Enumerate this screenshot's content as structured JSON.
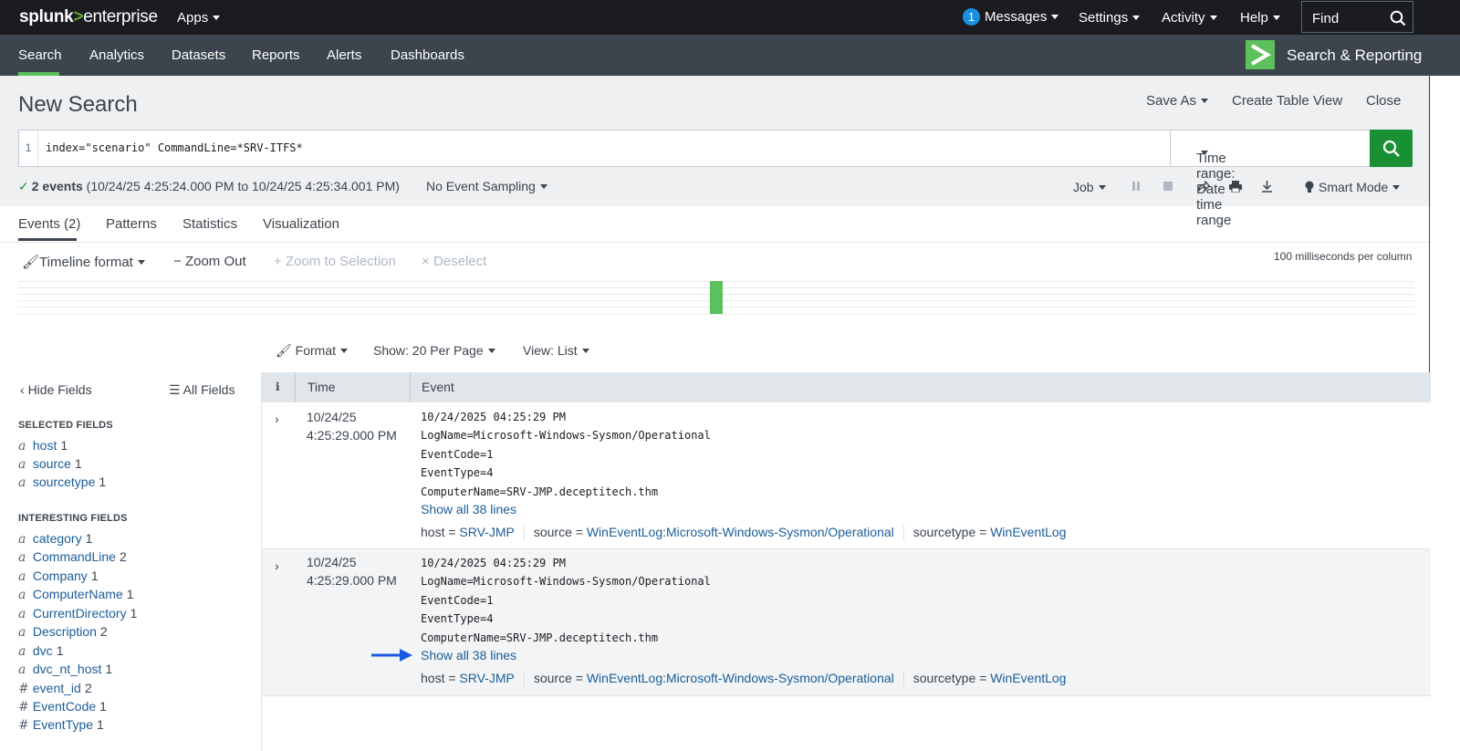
{
  "topbar": {
    "logo_a": "splunk",
    "logo_b": ">",
    "logo_c": "enterprise",
    "apps": "Apps",
    "messages_count": "1",
    "messages": "Messages",
    "settings": "Settings",
    "activity": "Activity",
    "help": "Help",
    "find": "Find"
  },
  "appnav": {
    "items": [
      "Search",
      "Analytics",
      "Datasets",
      "Reports",
      "Alerts",
      "Dashboards"
    ],
    "active": "Search",
    "app_name": "Search & Reporting",
    "accent": "#5cc05c"
  },
  "header": {
    "title": "New Search",
    "save_as": "Save As",
    "create_table_view": "Create Table View",
    "close": "Close"
  },
  "search": {
    "line_number": "1",
    "query": "index=\"scenario\" CommandLine=*SRV-ITFS*",
    "time_range": "Time range: Date time range"
  },
  "status": {
    "events_bold": "2 events",
    "range": "(10/24/25 4:25:24.000 PM to 10/24/25 4:25:34.001 PM)",
    "sampling": "No Event Sampling",
    "job": "Job",
    "mode": "Smart Mode"
  },
  "tabs": [
    "Events (2)",
    "Patterns",
    "Statistics",
    "Visualization"
  ],
  "timeline": {
    "format": "Timeline format",
    "zoom_out": "Zoom Out",
    "zoom_selection": "Zoom to Selection",
    "deselect": "Deselect",
    "scale": "100 milliseconds per column"
  },
  "format_bar": {
    "format": "Format",
    "show": "Show: 20 Per Page",
    "view": "View: List"
  },
  "sidebar": {
    "hide_fields": "Hide Fields",
    "all_fields": "All Fields",
    "selected_title": "SELECTED FIELDS",
    "selected": [
      {
        "type": "a",
        "name": "host",
        "count": "1"
      },
      {
        "type": "a",
        "name": "source",
        "count": "1"
      },
      {
        "type": "a",
        "name": "sourcetype",
        "count": "1"
      }
    ],
    "interesting_title": "INTERESTING FIELDS",
    "interesting": [
      {
        "type": "a",
        "name": "category",
        "count": "1"
      },
      {
        "type": "a",
        "name": "CommandLine",
        "count": "2"
      },
      {
        "type": "a",
        "name": "Company",
        "count": "1"
      },
      {
        "type": "a",
        "name": "ComputerName",
        "count": "1"
      },
      {
        "type": "a",
        "name": "CurrentDirectory",
        "count": "1"
      },
      {
        "type": "a",
        "name": "Description",
        "count": "2"
      },
      {
        "type": "a",
        "name": "dvc",
        "count": "1"
      },
      {
        "type": "a",
        "name": "dvc_nt_host",
        "count": "1"
      },
      {
        "type": "#",
        "name": "event_id",
        "count": "2"
      },
      {
        "type": "#",
        "name": "EventCode",
        "count": "1"
      },
      {
        "type": "#",
        "name": "EventType",
        "count": "1"
      }
    ]
  },
  "table": {
    "col_i": "i",
    "col_time": "Time",
    "col_event": "Event",
    "events": [
      {
        "date": "10/24/25",
        "time": "4:25:29.000 PM",
        "lines": [
          "10/24/2025 04:25:29 PM",
          "LogName=Microsoft-Windows-Sysmon/Operational",
          "EventCode=1",
          "EventType=4",
          "ComputerName=SRV-JMP.deceptitech.thm"
        ],
        "show_all": "Show all 38 lines",
        "host_k": "host =",
        "host_v": "SRV-JMP",
        "source_k": "source =",
        "source_v": "WinEventLog:Microsoft-Windows-Sysmon/Operational",
        "st_k": "sourcetype =",
        "st_v": "WinEventLog"
      },
      {
        "date": "10/24/25",
        "time": "4:25:29.000 PM",
        "lines": [
          "10/24/2025 04:25:29 PM",
          "LogName=Microsoft-Windows-Sysmon/Operational",
          "EventCode=1",
          "EventType=4",
          "ComputerName=SRV-JMP.deceptitech.thm"
        ],
        "show_all": "Show all 38 lines",
        "host_k": "host =",
        "host_v": "SRV-JMP",
        "source_k": "source =",
        "source_v": "WinEventLog:Microsoft-Windows-Sysmon/Operational",
        "st_k": "sourcetype =",
        "st_v": "WinEventLog"
      }
    ]
  },
  "annotation_arrow_color": "#1a5ae0"
}
